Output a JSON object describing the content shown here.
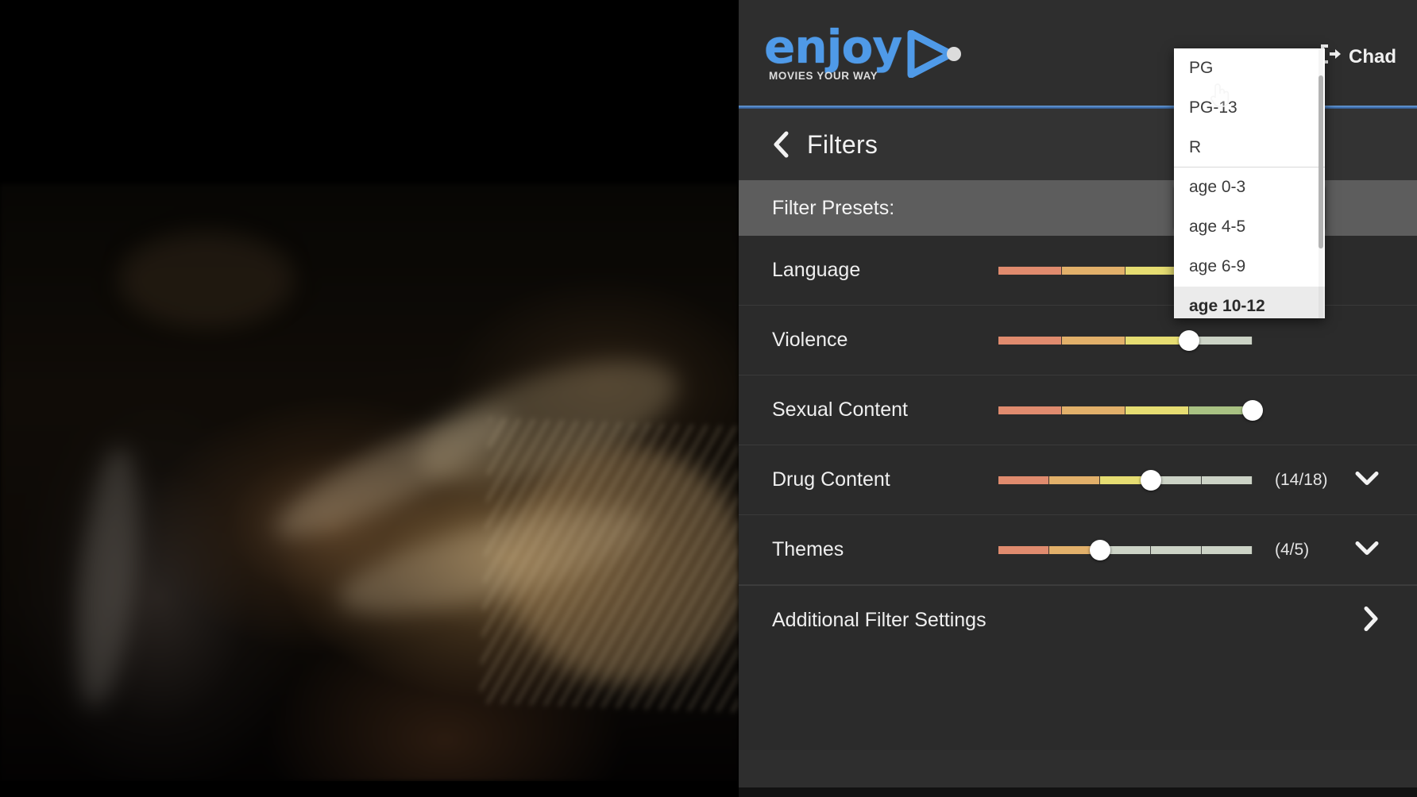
{
  "brand": {
    "word": "enjoy",
    "tagline": "MOVIES YOUR WAY",
    "logo_color": "#4f9ae8",
    "play_icon": "play-triangle-icon"
  },
  "user": {
    "name": "Chad",
    "icon": "sign-out-icon"
  },
  "header": {
    "title": "Filters",
    "back_icon": "chevron-left-icon",
    "accent_rule_color": "#4477b8"
  },
  "preset": {
    "label": "Filter Presets:",
    "selected": "age 10-12",
    "caret_icon": "chevron-down-icon",
    "options": [
      {
        "label": "PG",
        "divider_after": false,
        "selected": false
      },
      {
        "label": "PG-13",
        "divider_after": false,
        "selected": false
      },
      {
        "label": "R",
        "divider_after": true,
        "selected": false
      },
      {
        "label": "age 0-3",
        "divider_after": false,
        "selected": false
      },
      {
        "label": "age 4-5",
        "divider_after": false,
        "selected": false
      },
      {
        "label": "age 6-9",
        "divider_after": false,
        "selected": false
      },
      {
        "label": "age 10-12",
        "divider_after": false,
        "selected": true
      }
    ]
  },
  "slider_colors": [
    "#e08b6e",
    "#e2b06a",
    "#e6dd72",
    "#a9c283",
    "#cdd6c4",
    "#d3dacb"
  ],
  "filters": [
    {
      "label": "Language",
      "segments": 4,
      "value": 4,
      "count": "",
      "has_chevron": false
    },
    {
      "label": "Violence",
      "segments": 4,
      "value": 3,
      "count": "",
      "has_chevron": false
    },
    {
      "label": "Sexual Content",
      "segments": 4,
      "value": 4,
      "count": "",
      "has_chevron": false
    },
    {
      "label": "Drug Content",
      "segments": 5,
      "value": 3,
      "count": "(14/18)",
      "has_chevron": true
    },
    {
      "label": "Themes",
      "segments": 5,
      "value": 2,
      "count": "(4/5)",
      "has_chevron": true
    }
  ],
  "additional": {
    "label": "Additional Filter Settings",
    "chevron_icon": "chevron-right-icon"
  },
  "cursor": {
    "icon": "pointing-hand-cursor"
  }
}
